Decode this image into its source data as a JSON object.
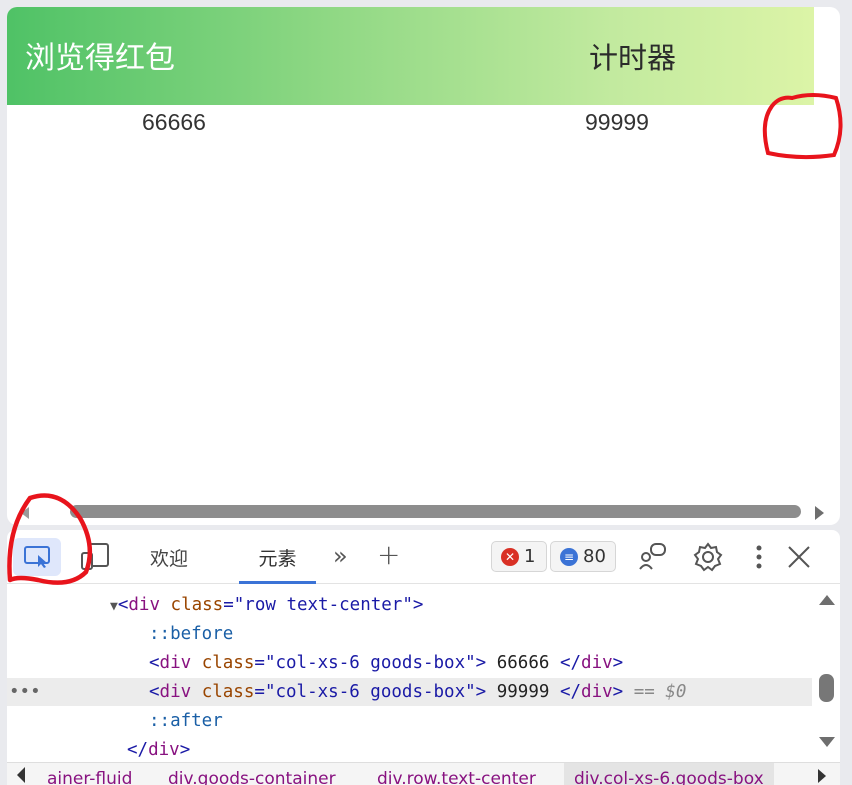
{
  "page": {
    "banner": {
      "left_text": "浏览得红包",
      "right_text": "计时器"
    },
    "cells": {
      "left": "66666",
      "right": "99999"
    }
  },
  "devtools": {
    "tabs": {
      "welcome": "欢迎",
      "elements": "元素"
    },
    "icons": {
      "inspect": "inspect-element-icon",
      "device": "device-toolbar-icon",
      "more": "more-tabs-icon",
      "add": "add-tab-icon",
      "feedback": "feedback-icon",
      "settings": "gear-icon",
      "menu": "kebab-menu-icon",
      "close": "close-icon"
    },
    "badges": {
      "errors": "1",
      "messages": "80",
      "error_color": "#d93025",
      "message_color": "#3b73d6"
    },
    "dom": {
      "line1_open": "<div ",
      "line1_attr": "class",
      "line1_val": "\"row text-center\"",
      "line1_close": ">",
      "before": "::before",
      "line3_attr": "class",
      "line3_val": "\"col-xs-6 goods-box\"",
      "line3_text": " 66666 ",
      "line4_val": "\"col-xs-6 goods-box\"",
      "line4_text": " 99999 ",
      "line4_suffix": " == $0",
      "after": "::after",
      "close_div": "</div>",
      "open_div": "<div ",
      "close_tag": "</div>",
      "gt": ">",
      "eq": "="
    },
    "breadcrumbs": [
      "ainer-fluid",
      "div.goods-container",
      "div.row.text-center",
      "div.col-xs-6.goods-box"
    ]
  },
  "annotation_color": "#e8141c"
}
